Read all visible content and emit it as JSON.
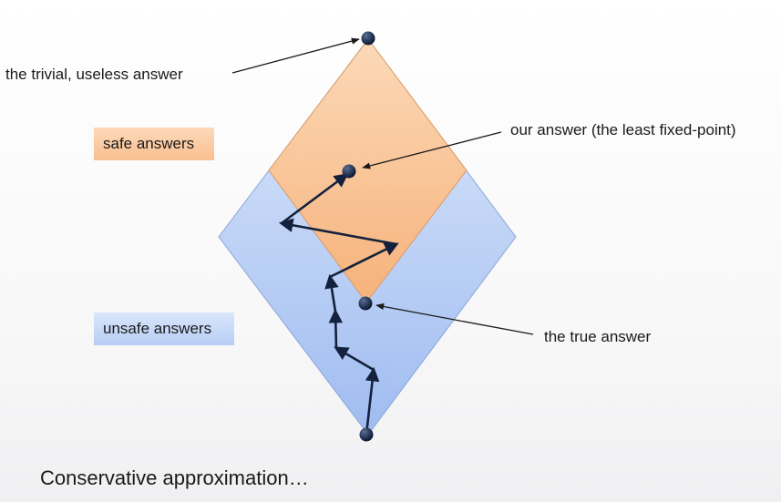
{
  "labels": {
    "trivial": "the trivial, useless answer",
    "our_answer": "our answer (the least fixed-point)",
    "true_answer": "the true answer",
    "safe": "safe answers",
    "unsafe": "unsafe answers"
  },
  "caption": "Conservative approximation…",
  "colors": {
    "safe_fill": "#f9bf8f",
    "unsafe_fill": "#b8cdf5",
    "arrow": "#14213d",
    "dot": "#0f1c33"
  }
}
